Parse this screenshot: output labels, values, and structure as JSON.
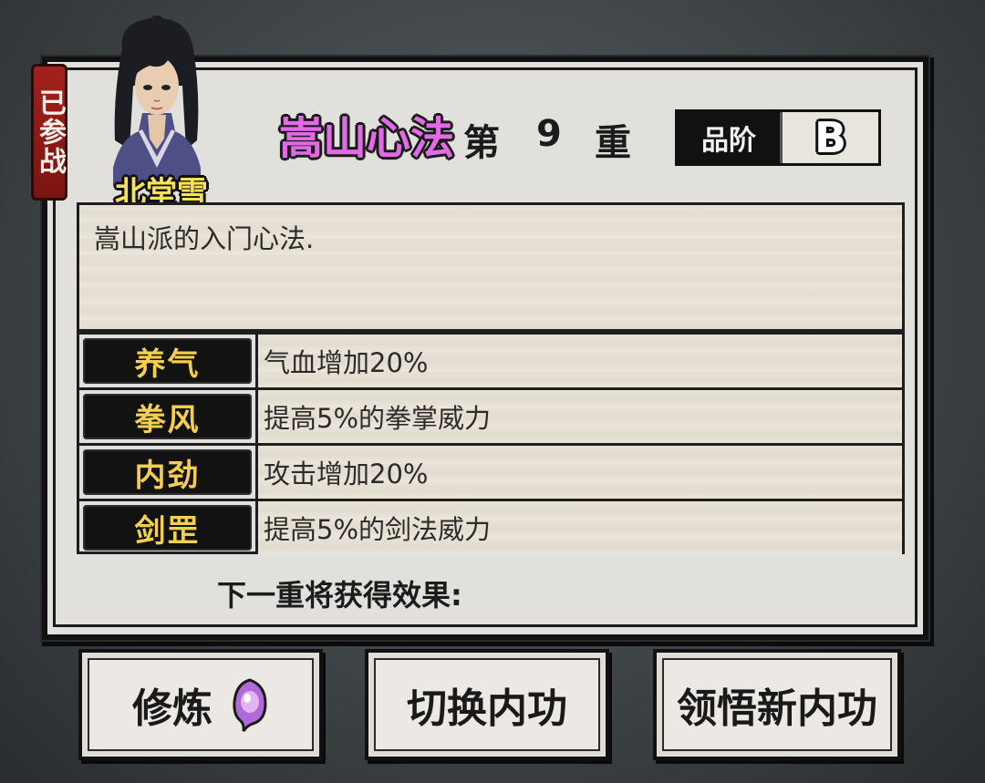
{
  "status": {
    "deployed_label": "已参战"
  },
  "character": {
    "name": "北堂雪"
  },
  "skill": {
    "name": "嵩山心法",
    "level_prefix": "第",
    "level": "9",
    "level_suffix": "重",
    "grade_label": "品阶",
    "grade": "B",
    "description": "嵩山派的入门心法."
  },
  "effects": [
    {
      "name": "养气",
      "effect": "气血增加20%"
    },
    {
      "name": "拳风",
      "effect": "提高5%的拳掌威力"
    },
    {
      "name": "内劲",
      "effect": "攻击增加20%"
    },
    {
      "name": "剑罡",
      "effect": "提高5%的剑法威力"
    }
  ],
  "next_level_label": "下一重将获得效果:",
  "buttons": {
    "train": "修炼",
    "switch": "切换内功",
    "learn": "领悟新内功"
  },
  "colors": {
    "skill_name": "#e26ae6",
    "effect_key": "#f3cf4f",
    "name_label": "#f7e25a",
    "status_tag": "#a3201d",
    "spirit_icon": "#b06ad8"
  }
}
